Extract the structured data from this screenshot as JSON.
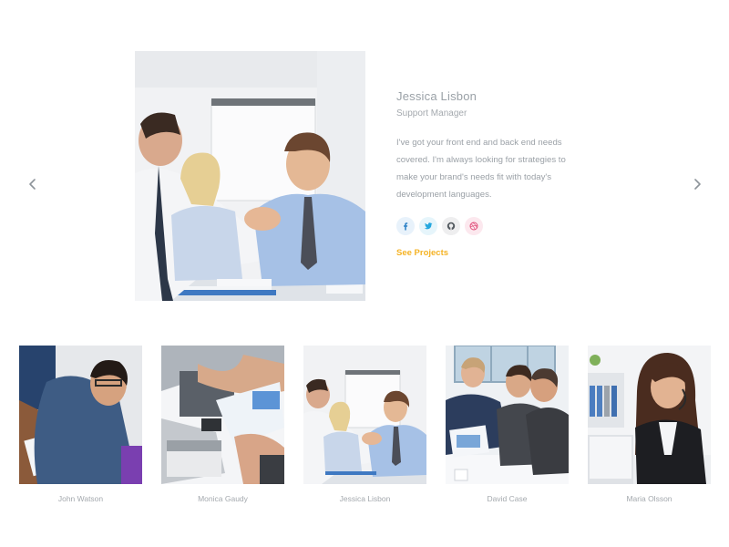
{
  "featured": {
    "name": "Jessica Lisbon",
    "role": "Support Manager",
    "bio": "I've got your front end and back end needs covered. I'm always looking for strategies to make your brand's needs fit with today's development languages.",
    "cta_label": "See Projects",
    "cta_color": "#f5b325",
    "socials": [
      {
        "icon": "facebook-icon",
        "color": "#2f83c7",
        "bg": "#e8f2fb"
      },
      {
        "icon": "twitter-icon",
        "color": "#24a7de",
        "bg": "#e6f5fb"
      },
      {
        "icon": "github-icon",
        "color": "#555b61",
        "bg": "#eeeeef"
      },
      {
        "icon": "dribbble-icon",
        "color": "#e14f7b",
        "bg": "#fce8ee"
      }
    ]
  },
  "nav": {
    "prev_icon": "chevron-left-icon",
    "next_icon": "chevron-right-icon"
  },
  "team": [
    {
      "name": "John Watson"
    },
    {
      "name": "Monica Gaudy"
    },
    {
      "name": "Jessica Lisbon"
    },
    {
      "name": "David Case"
    },
    {
      "name": "Maria Olsson"
    }
  ]
}
